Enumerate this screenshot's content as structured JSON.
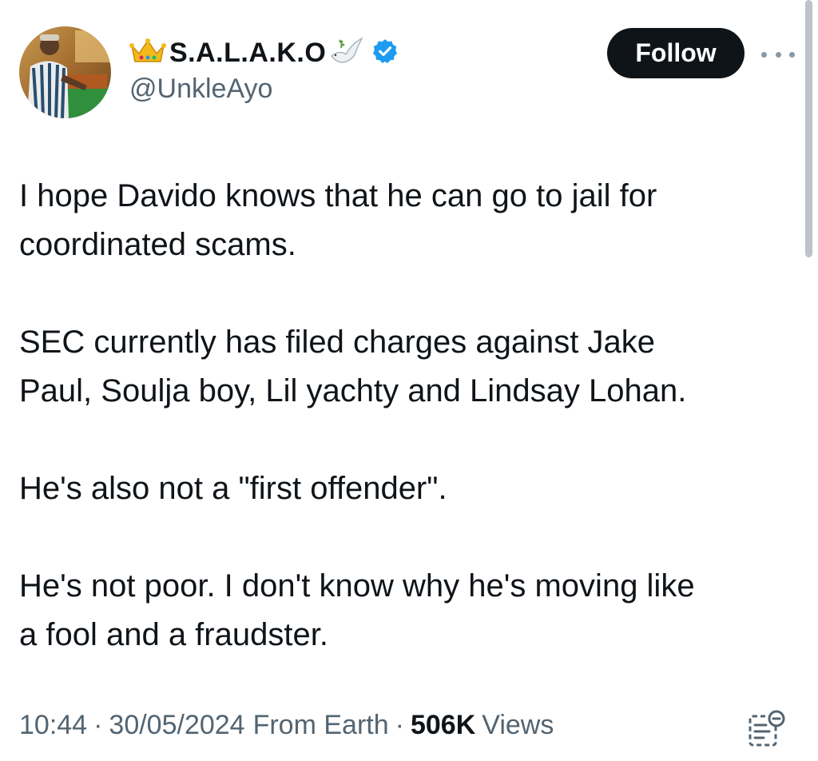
{
  "author": {
    "display_name": "S.A.L.A.K.O",
    "handle": "@UnkleAyo",
    "verified": true,
    "name_emojis": [
      "crown-emoji",
      "dove-emoji"
    ]
  },
  "actions": {
    "follow_label": "Follow",
    "more_icon": "ellipsis-icon"
  },
  "tweet": {
    "paragraphs": [
      "I hope Davido knows that he can go to jail for\ncoordinated scams.",
      "SEC currently has filed charges against Jake\nPaul, Soulja boy, Lil yachty and Lindsay Lohan.",
      "He's also not a \"first offender\".",
      "He's not poor. I don't know why he's moving like\na fool and a fraudster."
    ]
  },
  "meta": {
    "time": "10:44",
    "separator": "·",
    "date": "30/05/2024",
    "location": "From Earth",
    "views_count": "506K",
    "views_label": "Views"
  },
  "colors": {
    "text_primary": "#0f1419",
    "text_secondary": "#536471",
    "verified_blue": "#1d9bf0",
    "follow_bg": "#0f1419"
  }
}
